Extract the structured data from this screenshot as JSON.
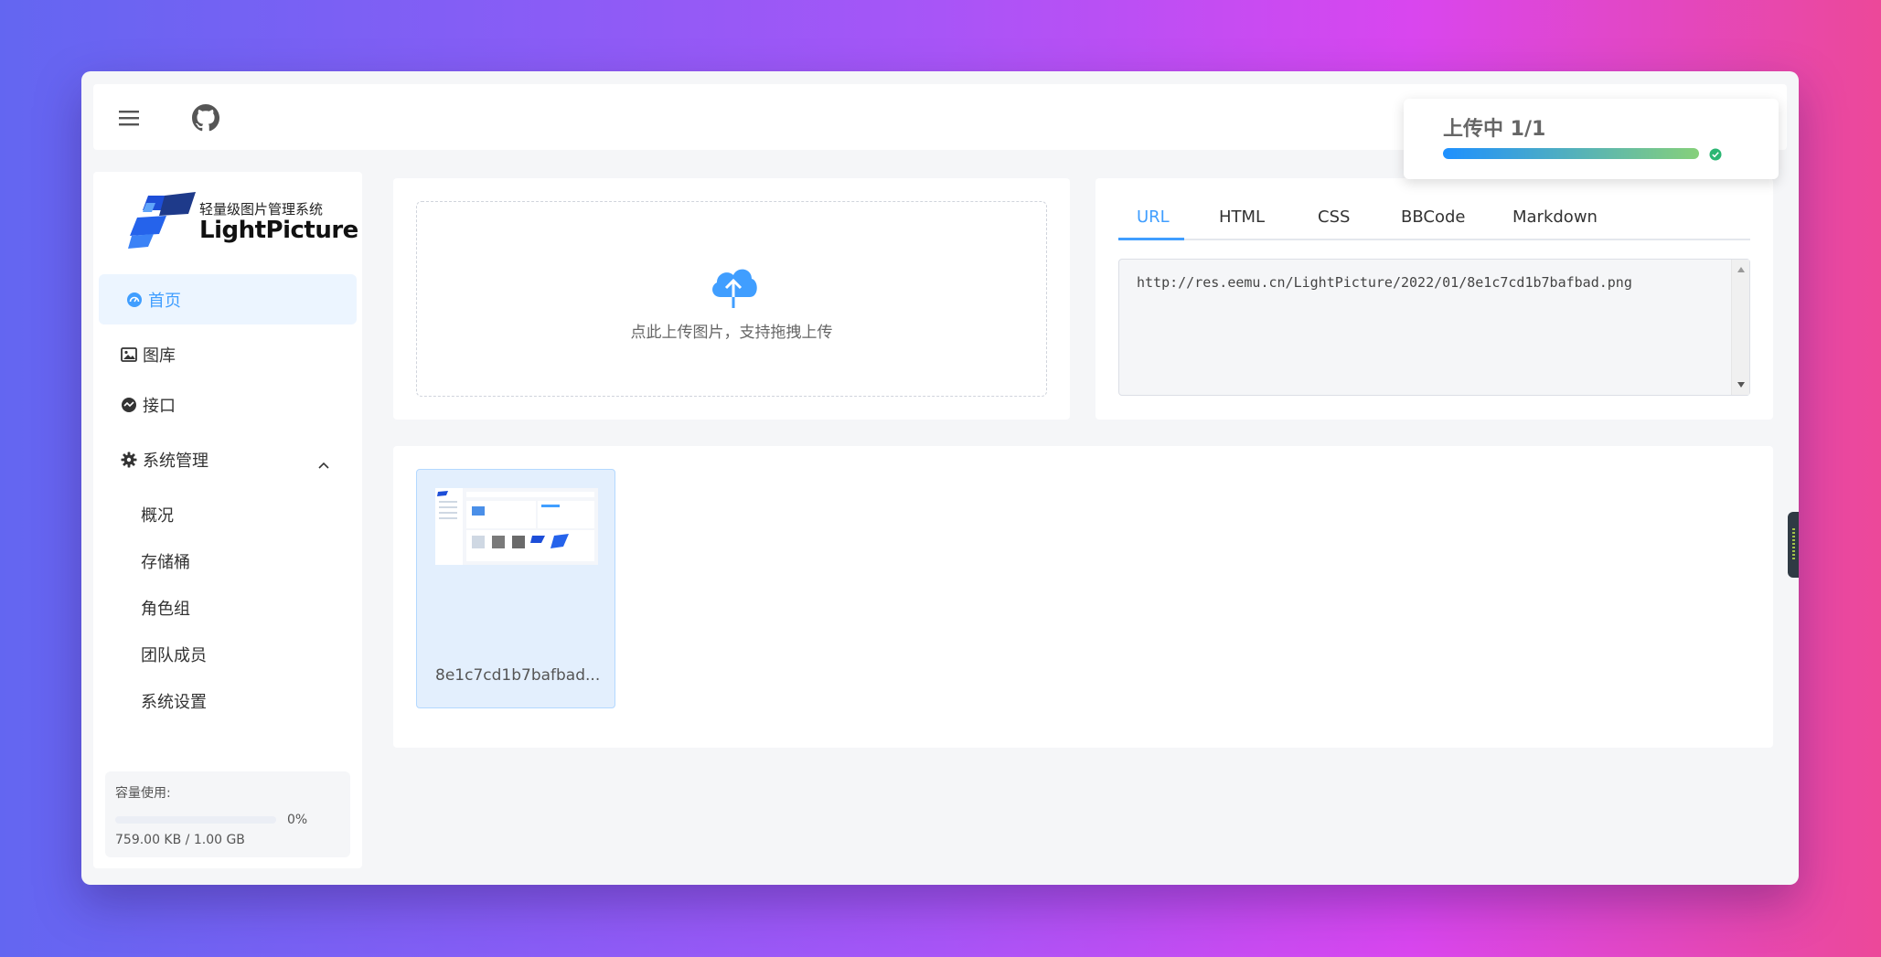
{
  "logo": {
    "subtitle": "轻量级图片管理系统",
    "name": "LightPicture"
  },
  "nav": {
    "home": "首页",
    "gallery": "图库",
    "api": "接口",
    "system": "系统管理",
    "sub_items": [
      "概况",
      "存储桶",
      "角色组",
      "团队成员",
      "系统设置"
    ]
  },
  "quota": {
    "label": "容量使用:",
    "percent_value": 0,
    "percent_text": "0%",
    "size": "759.00 KB / 1.00 GB"
  },
  "upload": {
    "hint": "点此上传图片，支持拖拽上传"
  },
  "link_tabs": {
    "url": "URL",
    "html": "HTML",
    "css": "CSS",
    "bbcode": "BBCode",
    "markdown": "Markdown",
    "active": "URL"
  },
  "link_value": "http://res.eemu.cn/LightPicture/2022/01/8e1c7cd1b7bafbad.png",
  "gallery": {
    "items": [
      {
        "name": "8e1c7cd1b7bafbad...."
      }
    ]
  },
  "upload_notice": {
    "title": "上传中 1/1",
    "progress": 1.0,
    "status_color": "#2bb673"
  },
  "colors": {
    "primary": "#409eff",
    "active_bg": "#ecf5ff"
  },
  "icons": [
    "menu-icon",
    "github-icon",
    "dashboard-icon",
    "picture-icon",
    "api-icon",
    "gear-icon",
    "chevron-up-icon",
    "cloud-upload-icon",
    "check-circle-icon"
  ]
}
